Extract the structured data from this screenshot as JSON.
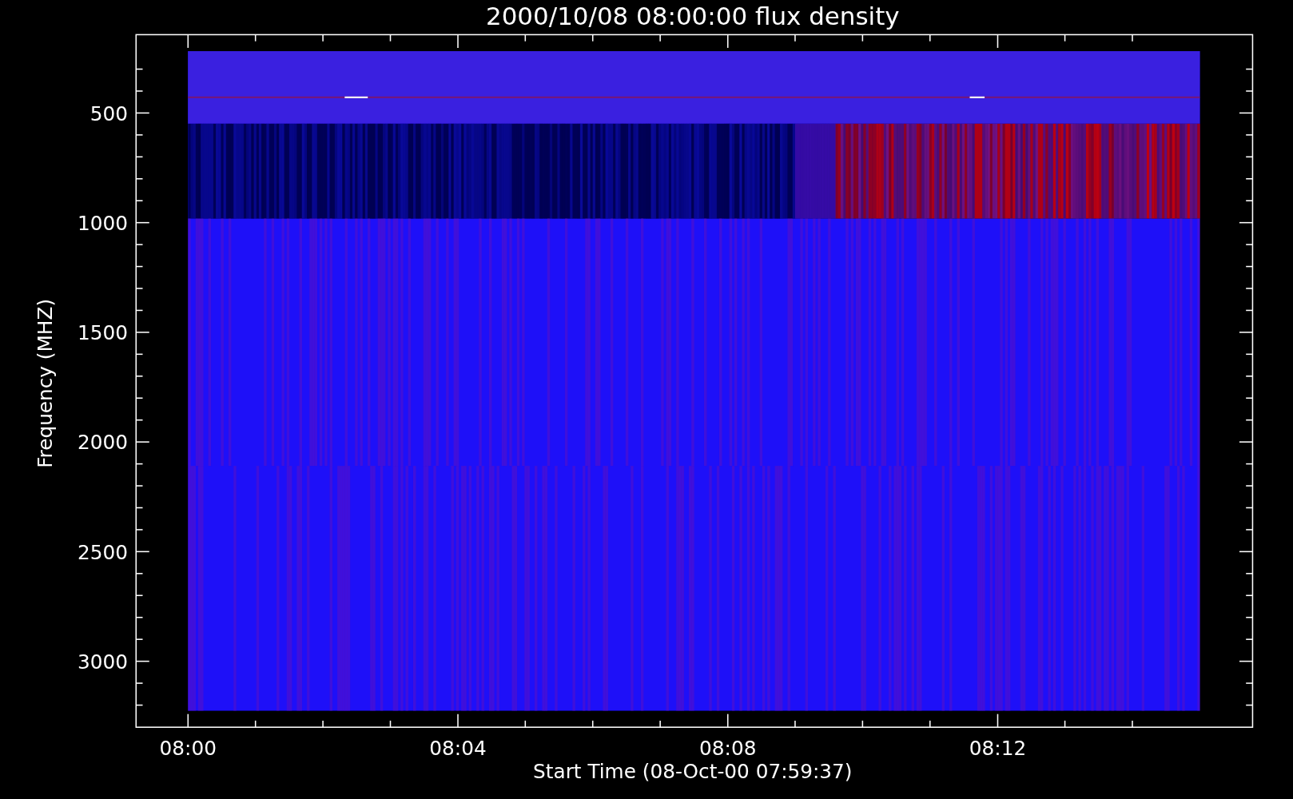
{
  "plot": {
    "title": "2000/10/08 08:00:00 flux density",
    "ylabel": "Frequency (MHZ)",
    "xlabel": "Start Time (08-Oct-00 07:59:37)",
    "yticks": [
      "500",
      "1000",
      "1500",
      "2000",
      "2500",
      "3000"
    ],
    "xticks": [
      "08:00",
      "08:04",
      "08:08",
      "08:12"
    ]
  }
}
